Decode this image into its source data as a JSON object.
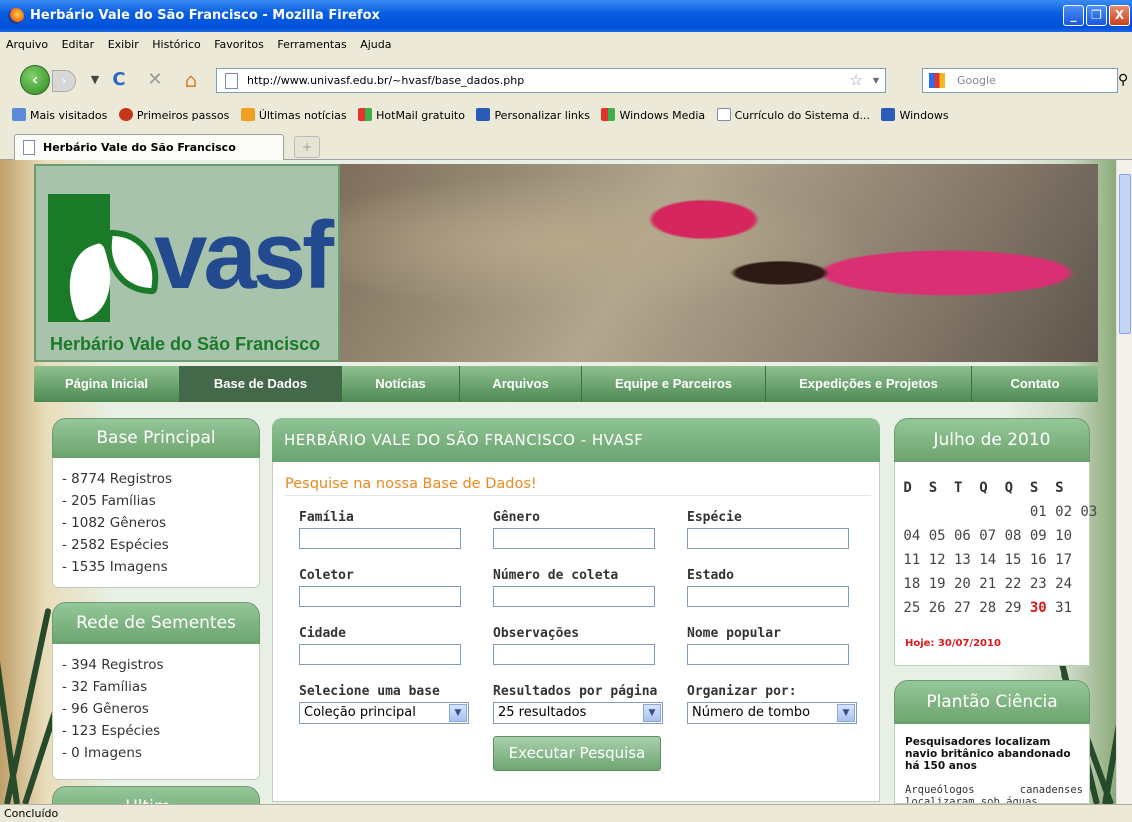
{
  "window": {
    "title": "Herbário Vale do São Francisco - Mozilla Firefox",
    "min": "_",
    "max": "❐",
    "close": "X"
  },
  "menubar": [
    "Arquivo",
    "Editar",
    "Exibir",
    "Histórico",
    "Favoritos",
    "Ferramentas",
    "Ajuda"
  ],
  "nav": {
    "back": "‹",
    "forward": "›",
    "reload": "C",
    "stop": "✕",
    "home": "⌂",
    "url": "http://www.univasf.edu.br/~hvasf/base_dados.php",
    "star": "☆",
    "search_placeholder": "Google",
    "search_icon": "⚲"
  },
  "bookmarks": [
    "Mais visitados",
    "Primeiros passos",
    "Últimas notícias",
    "HotMail gratuito",
    "Personalizar links",
    "Windows Media",
    "Currículo do Sistema d...",
    "Windows"
  ],
  "tab": {
    "label": "Herbário Vale do São Francisco",
    "new_tab": "+"
  },
  "logo": {
    "word": "vasf",
    "subtitle": "Herbário Vale do São Francisco"
  },
  "site_menu": [
    {
      "label": "Página Inicial",
      "active": false
    },
    {
      "label": "Base de Dados",
      "active": true
    },
    {
      "label": "Notícias",
      "active": false
    },
    {
      "label": "Arquivos",
      "active": false
    },
    {
      "label": "Equipe e Parceiros",
      "active": false
    },
    {
      "label": "Expedições e Projetos",
      "active": false
    },
    {
      "label": "Contato",
      "active": false
    }
  ],
  "base_principal": {
    "title": "Base Principal",
    "items": [
      "- 8774 Registros",
      "- 205 Famílias",
      "- 1082 Gêneros",
      "- 2582 Espécies",
      "- 1535 Imagens"
    ]
  },
  "rede_sementes": {
    "title": "Rede de Sementes",
    "items": [
      "- 394 Registros",
      "- 32 Famílias",
      "- 96 Gêneros",
      "- 123 Espécies",
      "- 0 Imagens"
    ]
  },
  "third_box": {
    "title": "Ultim..."
  },
  "main": {
    "header": "HERBÁRIO VALE DO SÃO FRANCISCO - HVASF",
    "search_title": "Pesquise na nossa Base de Dados!",
    "fields": {
      "familia": "Família",
      "genero": "Gênero",
      "especie": "Espécie",
      "coletor": "Coletor",
      "numero": "Número de coleta",
      "estado": "Estado",
      "cidade": "Cidade",
      "obs": "Observações",
      "nome": "Nome popular"
    },
    "selects": {
      "base_label": "Selecione uma base",
      "base_value": "Coleção principal",
      "result_label": "Resultados por página",
      "result_value": "25 resultados",
      "order_label": "Organizar por:",
      "order_value": "Número de tombo"
    },
    "button": "Executar Pesquisa"
  },
  "calendar": {
    "title": "Julho de 2010",
    "head": " D  S  T  Q  Q  S  S",
    "row1": "                01 02 03",
    "row2": " 04 05 06 07 08 09 10",
    "row3": " 11 12 13 14 15 16 17",
    "row4": " 18 19 20 21 22 23 24",
    "row5a": " 25 26 27 28 29 ",
    "row5today": "30",
    "row5b": " 31",
    "today_label": "Hoje: 30/07/2010"
  },
  "plantao": {
    "title": "Plantão Ciência",
    "news_title": "Pesquisadores localizam navio britânico abandonado há 150 anos",
    "news_text": "Arqueólogos canadenses localizaram sob águas"
  },
  "status": "Concluído",
  "colors": {
    "green_header": "#7ab37e",
    "orange": "#e78a20",
    "today_red": "#d71a1a"
  }
}
